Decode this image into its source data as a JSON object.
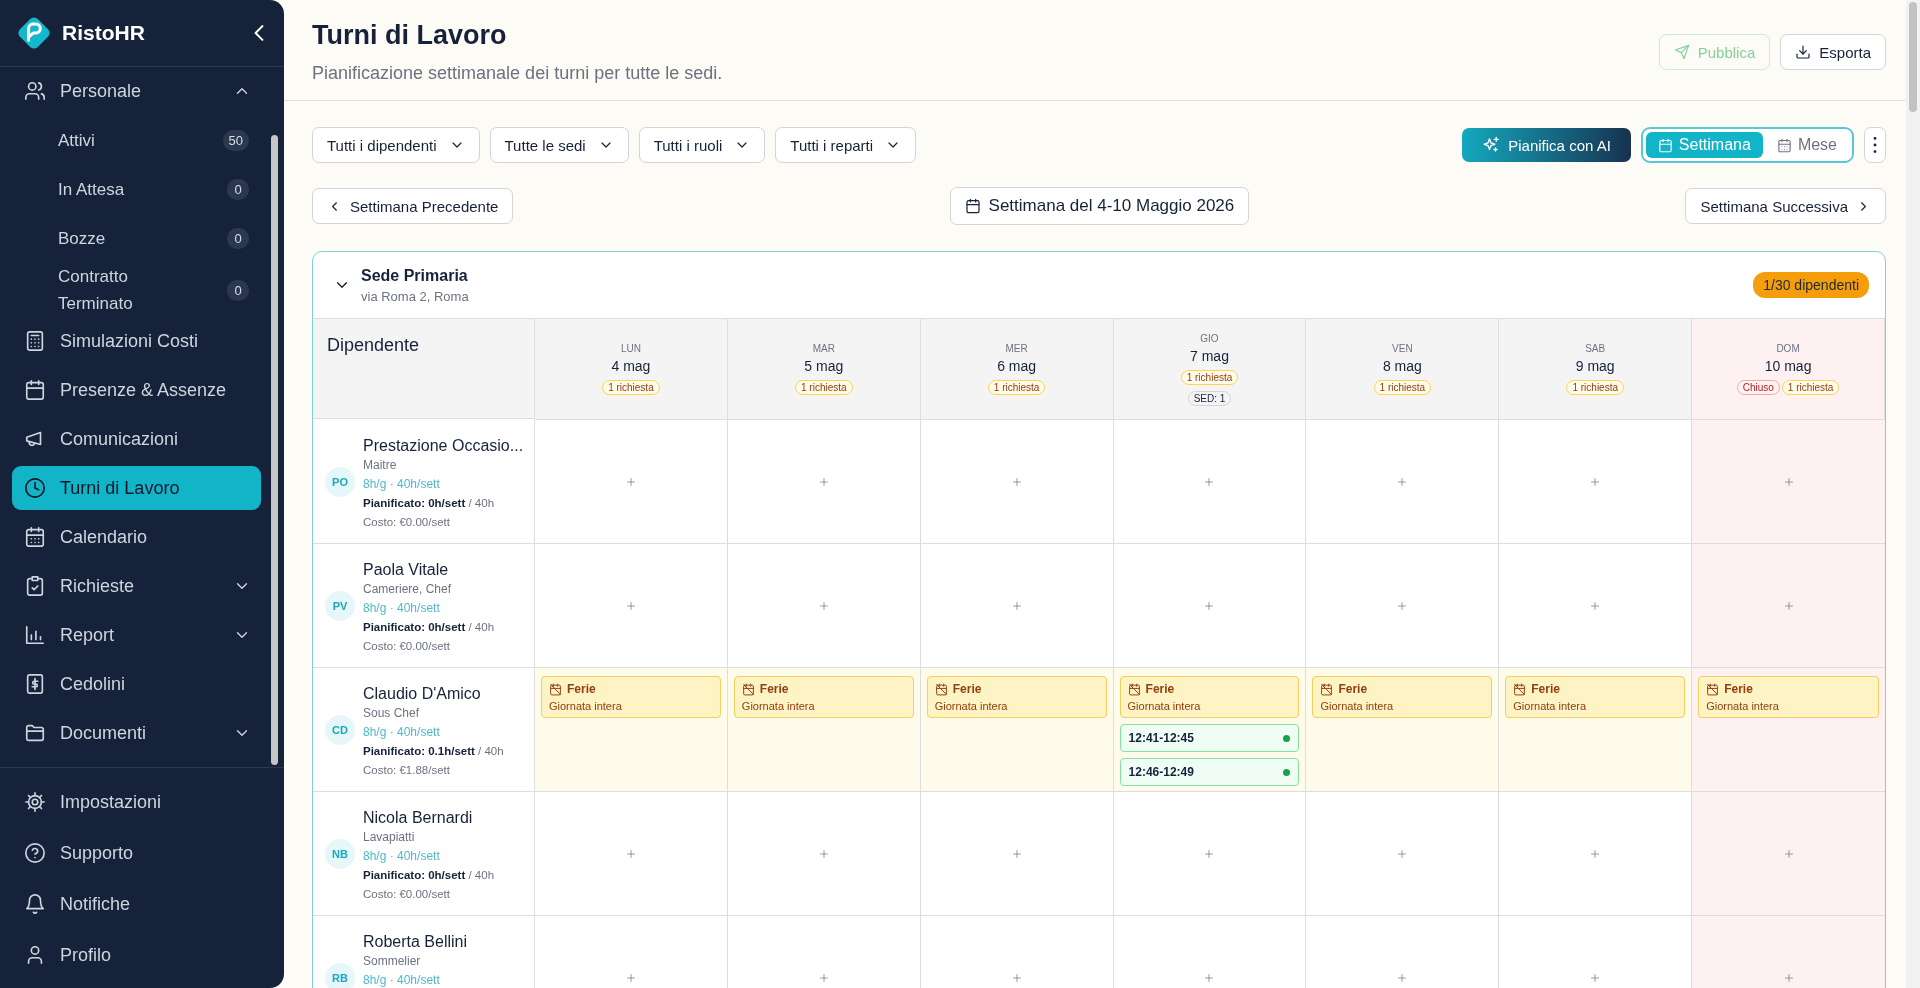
{
  "sidebar": {
    "brand": "RistoHR",
    "items": [
      {
        "label": "Personale",
        "kind": "group",
        "expanded": true,
        "selected": false,
        "children": [
          {
            "label": "Attivi",
            "count": "50",
            "selected": false
          },
          {
            "label": "In Attesa",
            "count": "0",
            "selected": false
          },
          {
            "label": "Bozze",
            "count": "0",
            "selected": false
          },
          {
            "label": "Contratto Terminato",
            "count": "0",
            "selected": false
          }
        ]
      },
      {
        "label": "Simulazioni Costi",
        "kind": "link",
        "selected": false
      },
      {
        "label": "Presenze & Assenze",
        "kind": "link",
        "selected": false
      },
      {
        "label": "Comunicazioni",
        "kind": "link",
        "selected": false
      },
      {
        "label": "Turni di Lavoro",
        "kind": "link",
        "selected": true
      },
      {
        "label": "Calendario",
        "kind": "link",
        "selected": false
      },
      {
        "label": "Richieste",
        "kind": "group",
        "expanded": false,
        "selected": false
      },
      {
        "label": "Report",
        "kind": "group",
        "expanded": false,
        "selected": false
      },
      {
        "label": "Cedolini",
        "kind": "link",
        "selected": false
      },
      {
        "label": "Documenti",
        "kind": "group",
        "expanded": false,
        "selected": false
      }
    ],
    "footer_items": [
      {
        "label": "Impostazioni",
        "selected": false
      },
      {
        "label": "Supporto",
        "selected": false
      },
      {
        "label": "Notifiche",
        "selected": false
      },
      {
        "label": "Profilo",
        "selected": false
      }
    ]
  },
  "header": {
    "title": "Turni di Lavoro",
    "subtitle": "Pianificazione settimanale dei turni per tutte le sedi.",
    "buttons": [
      {
        "label": "Pubblica",
        "kind": "publish",
        "disabled": true
      },
      {
        "label": "Esporta",
        "kind": "export",
        "disabled": false
      }
    ]
  },
  "filters": [
    "Tutti i dipendenti",
    "Tutte le sedi",
    "Tutti i ruoli",
    "Tutti i reparti"
  ],
  "ai_button": "Pianifica con AI",
  "view_tabs": [
    {
      "label": "Settimana",
      "selected": true
    },
    {
      "label": "Mese",
      "selected": false
    }
  ],
  "week_nav": {
    "previous": "Settimana Precedente",
    "current": "Settimana del 4-10 Maggio 2026",
    "next": "Settimana Successiva"
  },
  "location": {
    "name": "Sede Primaria",
    "address": "via Roma 2, Roma",
    "expanded": true,
    "badge": "1/30 dipendenti",
    "employee_heading": "Dipendente",
    "days": [
      {
        "dow": "LUN",
        "date": "4 mag",
        "closed": false,
        "badges": [
          {
            "kind": "request",
            "text": "1 richiesta"
          }
        ]
      },
      {
        "dow": "MAR",
        "date": "5 mag",
        "closed": false,
        "badges": [
          {
            "kind": "request",
            "text": "1 richiesta"
          }
        ]
      },
      {
        "dow": "MER",
        "date": "6 mag",
        "closed": false,
        "badges": [
          {
            "kind": "request",
            "text": "1 richiesta"
          }
        ]
      },
      {
        "dow": "GIO",
        "date": "7 mag",
        "closed": false,
        "badges": [
          {
            "kind": "request",
            "text": "1 richiesta"
          },
          {
            "kind": "count",
            "text": "SED: 1"
          }
        ]
      },
      {
        "dow": "VEN",
        "date": "8 mag",
        "closed": false,
        "badges": [
          {
            "kind": "request",
            "text": "1 richiesta"
          }
        ]
      },
      {
        "dow": "SAB",
        "date": "9 mag",
        "closed": false,
        "badges": [
          {
            "kind": "request",
            "text": "1 richiesta"
          }
        ]
      },
      {
        "dow": "DOM",
        "date": "10 mag",
        "closed": true,
        "badges": [
          {
            "kind": "closed",
            "text": "Chiuso"
          },
          {
            "kind": "request",
            "text": "1 richiesta"
          }
        ]
      }
    ],
    "employees": [
      {
        "initials": "PO",
        "name": "Prestazione Occasio...",
        "role": "Maitre",
        "hours": "8h/g · 40h/sett",
        "planned_label": "Pianificato:",
        "planned": "0h/sett",
        "target": "/ 40h",
        "cost": "Costo: €0.00/sett",
        "cells": [
          {
            "kind": "empty"
          },
          {
            "kind": "empty"
          },
          {
            "kind": "empty"
          },
          {
            "kind": "empty"
          },
          {
            "kind": "empty"
          },
          {
            "kind": "empty"
          },
          {
            "kind": "empty"
          }
        ]
      },
      {
        "initials": "PV",
        "name": "Paola Vitale",
        "role": "Cameriere, Chef",
        "hours": "8h/g · 40h/sett",
        "planned_label": "Pianificato:",
        "planned": "0h/sett",
        "target": "/ 40h",
        "cost": "Costo: €0.00/sett",
        "cells": [
          {
            "kind": "empty"
          },
          {
            "kind": "empty"
          },
          {
            "kind": "empty"
          },
          {
            "kind": "empty"
          },
          {
            "kind": "empty"
          },
          {
            "kind": "empty"
          },
          {
            "kind": "empty"
          }
        ]
      },
      {
        "initials": "CD",
        "name": "Claudio D'Amico",
        "role": "Sous Chef",
        "hours": "8h/g · 40h/sett",
        "planned_label": "Pianificato:",
        "planned": "0.1h/sett",
        "target": "/ 40h",
        "cost": "Costo: €1.88/sett",
        "cells": [
          {
            "kind": "absence",
            "title": "Ferie",
            "detail": "Giornata intera"
          },
          {
            "kind": "absence",
            "title": "Ferie",
            "detail": "Giornata intera"
          },
          {
            "kind": "absence",
            "title": "Ferie",
            "detail": "Giornata intera"
          },
          {
            "kind": "absence",
            "title": "Ferie",
            "detail": "Giornata intera",
            "shifts": [
              {
                "time": "12:41-12:45",
                "confirmed": true
              },
              {
                "time": "12:46-12:49",
                "confirmed": true
              }
            ]
          },
          {
            "kind": "absence",
            "title": "Ferie",
            "detail": "Giornata intera"
          },
          {
            "kind": "absence",
            "title": "Ferie",
            "detail": "Giornata intera"
          },
          {
            "kind": "absence",
            "title": "Ferie",
            "detail": "Giornata intera"
          }
        ]
      },
      {
        "initials": "NB",
        "name": "Nicola Bernardi",
        "role": "Lavapiatti",
        "hours": "8h/g · 40h/sett",
        "planned_label": "Pianificato:",
        "planned": "0h/sett",
        "target": "/ 40h",
        "cost": "Costo: €0.00/sett",
        "cells": [
          {
            "kind": "empty"
          },
          {
            "kind": "empty"
          },
          {
            "kind": "empty"
          },
          {
            "kind": "empty"
          },
          {
            "kind": "empty"
          },
          {
            "kind": "empty"
          },
          {
            "kind": "empty"
          }
        ]
      },
      {
        "initials": "RB",
        "name": "Roberta Bellini",
        "role": "Sommelier",
        "hours": "8h/g · 40h/sett",
        "cells": [
          {
            "kind": "empty"
          },
          {
            "kind": "empty"
          },
          {
            "kind": "empty"
          },
          {
            "kind": "empty"
          },
          {
            "kind": "empty"
          },
          {
            "kind": "empty"
          },
          {
            "kind": "empty"
          }
        ]
      }
    ]
  }
}
